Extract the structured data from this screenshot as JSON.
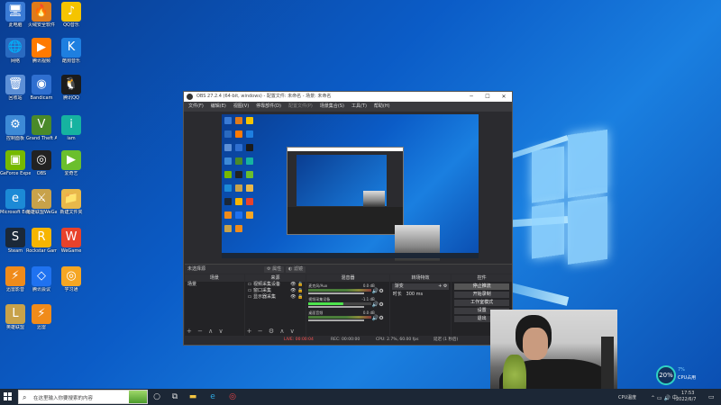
{
  "desktop": {
    "icons": [
      {
        "label": "此电脑",
        "glyph": "🖥",
        "color": "#3a7bd5"
      },
      {
        "label": "火绒安全软件",
        "glyph": "🔥",
        "color": "#e07b1a"
      },
      {
        "label": "QQ音乐",
        "glyph": "♪",
        "color": "#f5c400"
      },
      {
        "label": "网络",
        "glyph": "🌐",
        "color": "#2a6ac0"
      },
      {
        "label": "腾讯视频",
        "glyph": "▶",
        "color": "#ff7a00"
      },
      {
        "label": "酷狗音乐",
        "glyph": "K",
        "color": "#1e7fe0"
      },
      {
        "label": "回收站",
        "glyph": "🗑",
        "color": "#5c8fd6"
      },
      {
        "label": "Bandicam",
        "glyph": "◉",
        "color": "#2f6fd0"
      },
      {
        "label": "腾讯QQ",
        "glyph": "🐧",
        "color": "#1b1b1b"
      },
      {
        "label": "控制面板",
        "glyph": "⚙",
        "color": "#3d8ad6"
      },
      {
        "label": "Grand Theft Auto V",
        "glyph": "V",
        "color": "#4a8a2a"
      },
      {
        "label": "iam",
        "glyph": "i",
        "color": "#16b3a0"
      },
      {
        "label": "GeForce Experience",
        "glyph": "▣",
        "color": "#76b900"
      },
      {
        "label": "OBS",
        "glyph": "◎",
        "color": "#222"
      },
      {
        "label": "爱奇艺",
        "glyph": "▶",
        "color": "#6bbf2d"
      },
      {
        "label": "Microsoft Edge",
        "glyph": "e",
        "color": "#1c8ad6"
      },
      {
        "label": "英雄联盟WeGame版",
        "glyph": "⚔",
        "color": "#c8a24a"
      },
      {
        "label": "新建文件夹",
        "glyph": "📁",
        "color": "#e8b84a"
      },
      {
        "label": "Steam",
        "glyph": "S",
        "color": "#1b2838"
      },
      {
        "label": "Rockstar Games",
        "glyph": "R",
        "color": "#f7b500"
      },
      {
        "label": "WeGame",
        "glyph": "W",
        "color": "#e8422b"
      },
      {
        "label": "迅雷影音",
        "glyph": "⚡",
        "color": "#f08b1a"
      },
      {
        "label": "腾讯会议",
        "glyph": "◇",
        "color": "#1f72f0"
      },
      {
        "label": "学习通",
        "glyph": "◎",
        "color": "#f5a623"
      },
      {
        "label": "英雄联盟",
        "glyph": "L",
        "color": "#c8a24a"
      },
      {
        "label": "迅雷",
        "glyph": "⚡",
        "color": "#f08b1a"
      }
    ]
  },
  "obs": {
    "title": "OBS 27.2.4 (64-bit, windows) - 配置文件: 未命名 - 场景: 未命名",
    "menu": [
      "文件(F)",
      "编辑(E)",
      "视图(V)",
      "停靠部件(D)",
      "配置文件(P)",
      "场景集合(S)",
      "工具(T)",
      "帮助(H)"
    ],
    "no_source": "未选择源",
    "properties_btn": "属性",
    "filters_btn": "滤镜",
    "docks": {
      "scenes": {
        "title": "场景",
        "items": [
          "场景"
        ]
      },
      "sources": {
        "title": "来源",
        "items": [
          "视频采集设备",
          "窗口采集",
          "显示器采集"
        ]
      },
      "mixer": {
        "title": "混音器",
        "rows": [
          {
            "name": "麦克风/Aux",
            "db": "0.0 dB"
          },
          {
            "name": "视频采集设备",
            "db": "-1.1 dB"
          },
          {
            "name": "桌面音频",
            "db": "0.0 dB"
          }
        ]
      },
      "transitions": {
        "title": "转场特效",
        "type": "渐变",
        "duration_label": "时长",
        "duration": "300 ms"
      },
      "controls": {
        "title": "控件",
        "buttons": [
          "停止推流",
          "开始录制",
          "工作室模式",
          "设置",
          "退出"
        ]
      }
    },
    "status": {
      "live": "LIVE: 00:00:04",
      "rec": "REC: 00:00:00",
      "cpu": "CPU: 2.7%, 60.00 fps",
      "delay": "延迟 (1 秒后)"
    }
  },
  "perf": {
    "percent": "20%",
    "cpu_temp": "7%",
    "cpu_label": "CPU占用"
  },
  "taskbar": {
    "search_placeholder": "在这里输入你要搜索的内容",
    "clock_time": "17:53",
    "clock_date": "2022/6/7",
    "tray_weather": "CPU温度"
  }
}
